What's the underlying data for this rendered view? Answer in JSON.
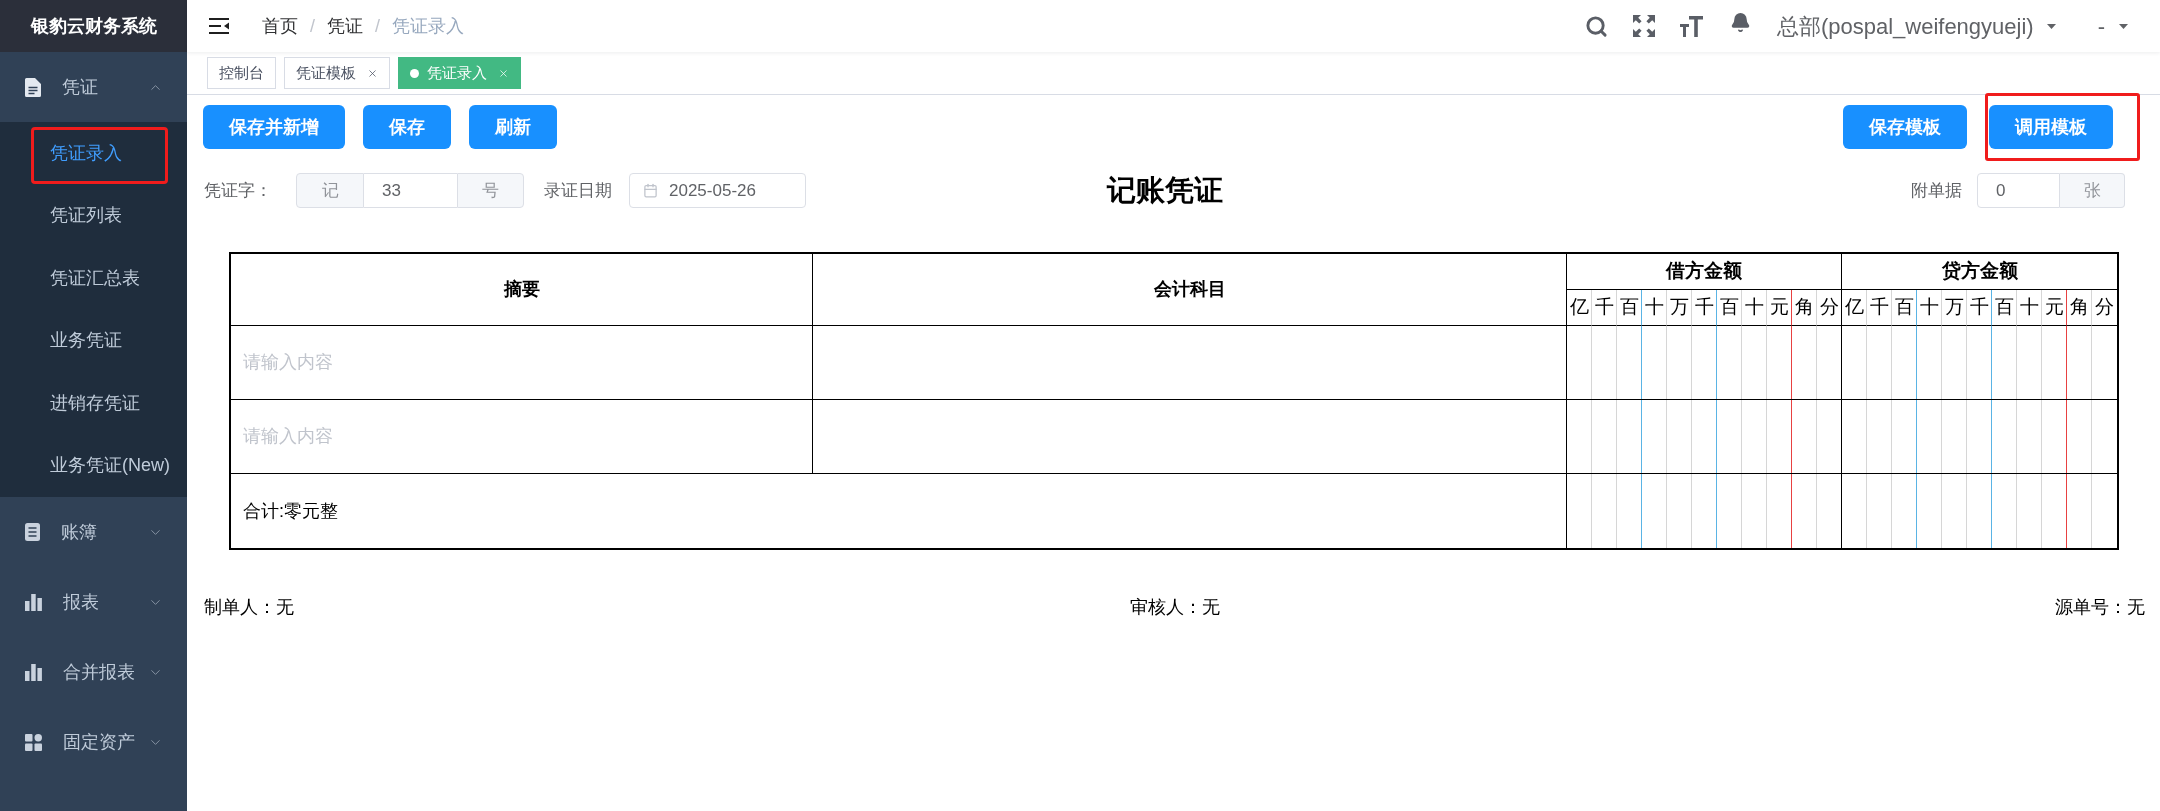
{
  "sidebar": {
    "title": "银豹云财务系统",
    "menu": [
      {
        "label": "凭证",
        "expanded": true,
        "children": [
          {
            "label": "凭证录入",
            "selected": true,
            "highlighted": true
          },
          {
            "label": "凭证列表",
            "selected": false,
            "highlighted": false
          },
          {
            "label": "凭证汇总表",
            "selected": false,
            "highlighted": false
          },
          {
            "label": "业务凭证",
            "selected": false,
            "highlighted": false
          },
          {
            "label": "进销存凭证",
            "selected": false,
            "highlighted": false
          },
          {
            "label": "业务凭证(New)",
            "selected": false,
            "highlighted": false
          }
        ]
      },
      {
        "label": "账簿",
        "expanded": false
      },
      {
        "label": "报表",
        "expanded": false
      },
      {
        "label": "合并报表",
        "expanded": false
      },
      {
        "label": "固定资产",
        "expanded": false
      }
    ]
  },
  "header": {
    "breadcrumb": [
      {
        "kind": "link",
        "label": "首页"
      },
      {
        "kind": "separator",
        "label": "/"
      },
      {
        "kind": "link",
        "label": "凭证"
      },
      {
        "kind": "separator",
        "label": "/"
      },
      {
        "kind": "current",
        "label": "凭证录入"
      }
    ],
    "account": "总部(pospal_weifengyueji)",
    "user": "-"
  },
  "tabs": [
    {
      "label": "控制台",
      "selected": false,
      "closable": false
    },
    {
      "label": "凭证模板",
      "selected": false,
      "closable": true
    },
    {
      "label": "凭证录入",
      "selected": true,
      "closable": true
    }
  ],
  "toolbar": {
    "left_buttons": [
      {
        "label": "保存并新增",
        "highlighted": false
      },
      {
        "label": "保存",
        "highlighted": false
      },
      {
        "label": "刷新",
        "highlighted": false
      }
    ],
    "right_buttons": [
      {
        "label": "保存模板",
        "highlighted": false
      },
      {
        "label": "调用模板",
        "highlighted": true
      }
    ]
  },
  "voucher": {
    "word_label": "凭证字：",
    "word": "记",
    "number": "33",
    "number_suffix": "号",
    "date_label": "录证日期",
    "date": "2025-05-26",
    "title": "记账凭证",
    "attachments_label": "附单据",
    "attachments": "0",
    "attachments_unit": "张"
  },
  "table": {
    "columns": [
      "摘要",
      "会计科目"
    ],
    "amount_groups": [
      {
        "label": "借方金额",
        "units": [
          "亿",
          "千",
          "百",
          "十",
          "万",
          "千",
          "百",
          "十",
          "元",
          "角",
          "分"
        ]
      },
      {
        "label": "贷方金额",
        "units": [
          "亿",
          "千",
          "百",
          "十",
          "万",
          "千",
          "百",
          "十",
          "元",
          "角",
          "分"
        ]
      }
    ],
    "rows": [
      {
        "placeholder": "请输入内容"
      },
      {
        "placeholder": "请输入内容"
      }
    ],
    "total": "合计:零元整"
  },
  "signatures": [
    "制单人：无",
    "审核人：无",
    "源单号：无"
  ]
}
